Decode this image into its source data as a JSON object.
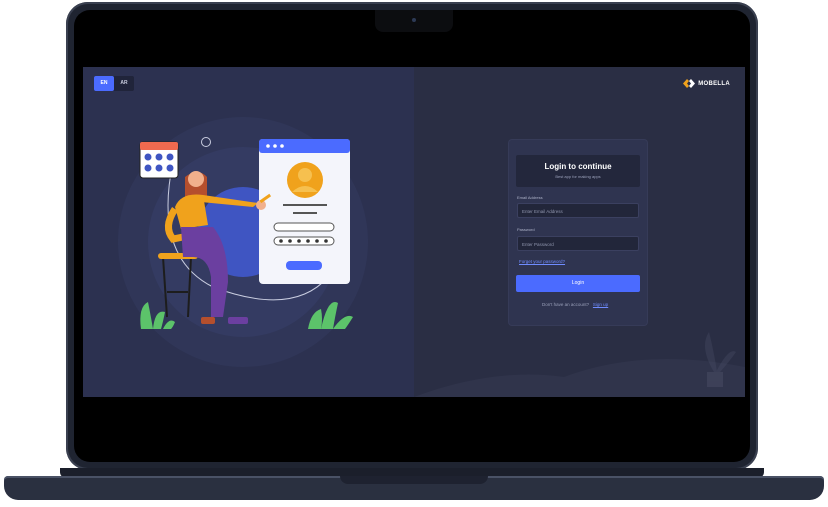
{
  "language_switch": {
    "options": [
      "EN",
      "AR"
    ],
    "selected": "EN"
  },
  "brand": {
    "name": "MOBELLA"
  },
  "login": {
    "title": "Login to continue",
    "subtitle": "Best app for making apps",
    "email_label": "Email Address",
    "email_placeholder": "Enter Email Address",
    "password_label": "Password",
    "password_placeholder": "Enter Password",
    "forgot_link": "Forget your password?",
    "login_button": "Login",
    "signup_prompt": "Don't have an account?",
    "signup_link": "Sign up"
  },
  "colors": {
    "accent": "#4b6bff",
    "left_panel": "#2c3150",
    "right_panel": "#2a2e44",
    "illustration_blue": "#3f55c2",
    "illustration_orange": "#f0a21c",
    "illustration_purple": "#6b3fa0",
    "plant_green": "#5cc36a"
  }
}
